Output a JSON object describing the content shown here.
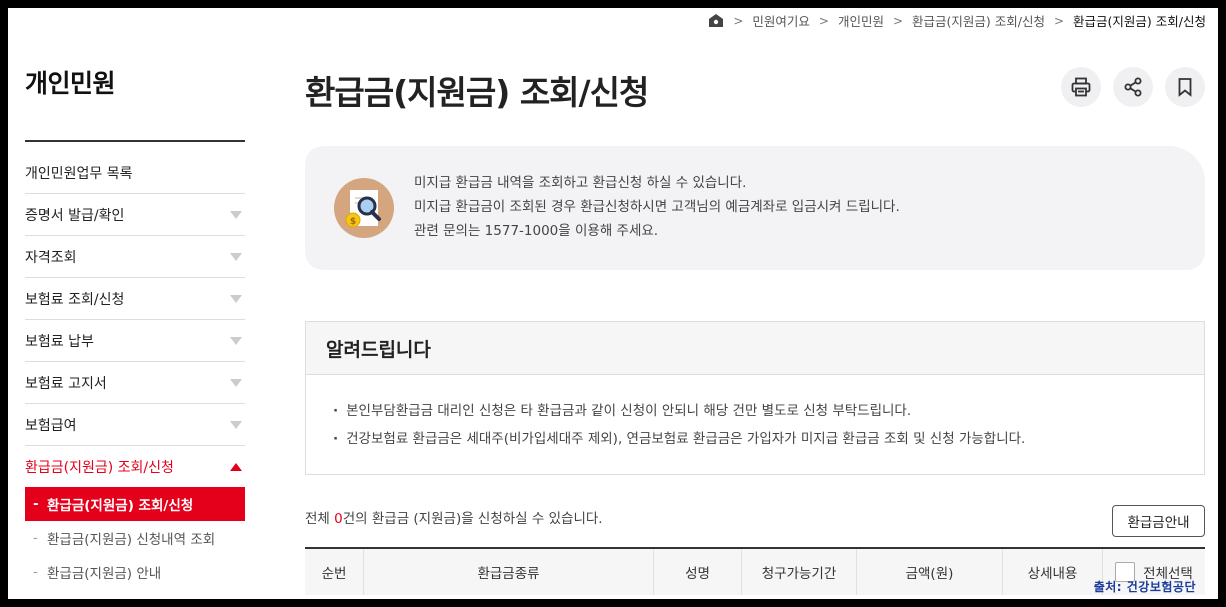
{
  "breadcrumb": {
    "items": [
      "민원여기요",
      "개인민원",
      "환급금(지원금) 조회/신청"
    ],
    "current": "환급금(지원금) 조회/신청"
  },
  "sidebar": {
    "title": "개인민원",
    "items": [
      {
        "label": "개인민원업무 목록"
      },
      {
        "label": "증명서 발급/확인"
      },
      {
        "label": "자격조회"
      },
      {
        "label": "보험료 조회/신청"
      },
      {
        "label": "보험료 납부"
      },
      {
        "label": "보험료 고지서"
      },
      {
        "label": "보험급여"
      },
      {
        "label": "환급금(지원금) 조회/신청"
      }
    ],
    "sub_items": [
      {
        "label": "환급금(지원금) 조회/신청"
      },
      {
        "label": "환급금(지원금) 신청내역 조회"
      },
      {
        "label": "환급금(지원금) 안내"
      }
    ]
  },
  "page": {
    "title": "환급금(지원금) 조회/신청",
    "tools": [
      "print-icon",
      "share-icon",
      "bookmark-icon"
    ]
  },
  "info": {
    "lines": [
      "미지급 환급금 내역을 조회하고 환급신청 하실 수 있습니다.",
      "미지급 환급금이 조회된 경우 환급신청하시면 고객님의 예금계좌로 입금시켜 드립니다.",
      "관련 문의는 1577-1000을 이용해 주세요."
    ]
  },
  "notice": {
    "title": "알려드립니다",
    "items": [
      "본인부담환급금 대리인 신청은 타 환급금과 같이 신청이 안되니 해당 건만 별도로 신청 부탁드립니다.",
      "건강보험료 환급금은 세대주(비가입세대주 제외), 연금보험료 환급금은 가입자가 미지급 환급금 조회 및 신청 가능합니다."
    ]
  },
  "results": {
    "prefix": "전체 ",
    "count": "0",
    "suffix": "건의 환급금 (지원금)을 신청하실 수 있습니다.",
    "guide_button": "환급금안내"
  },
  "table": {
    "headers": [
      "순번",
      "환급금종류",
      "성명",
      "청구가능기간",
      "금액(원)",
      "상세내용",
      "전체선택"
    ]
  },
  "source": "출처: 건강보험공단",
  "colors": {
    "accent": "#e4001b",
    "source": "#1a3a9c"
  }
}
